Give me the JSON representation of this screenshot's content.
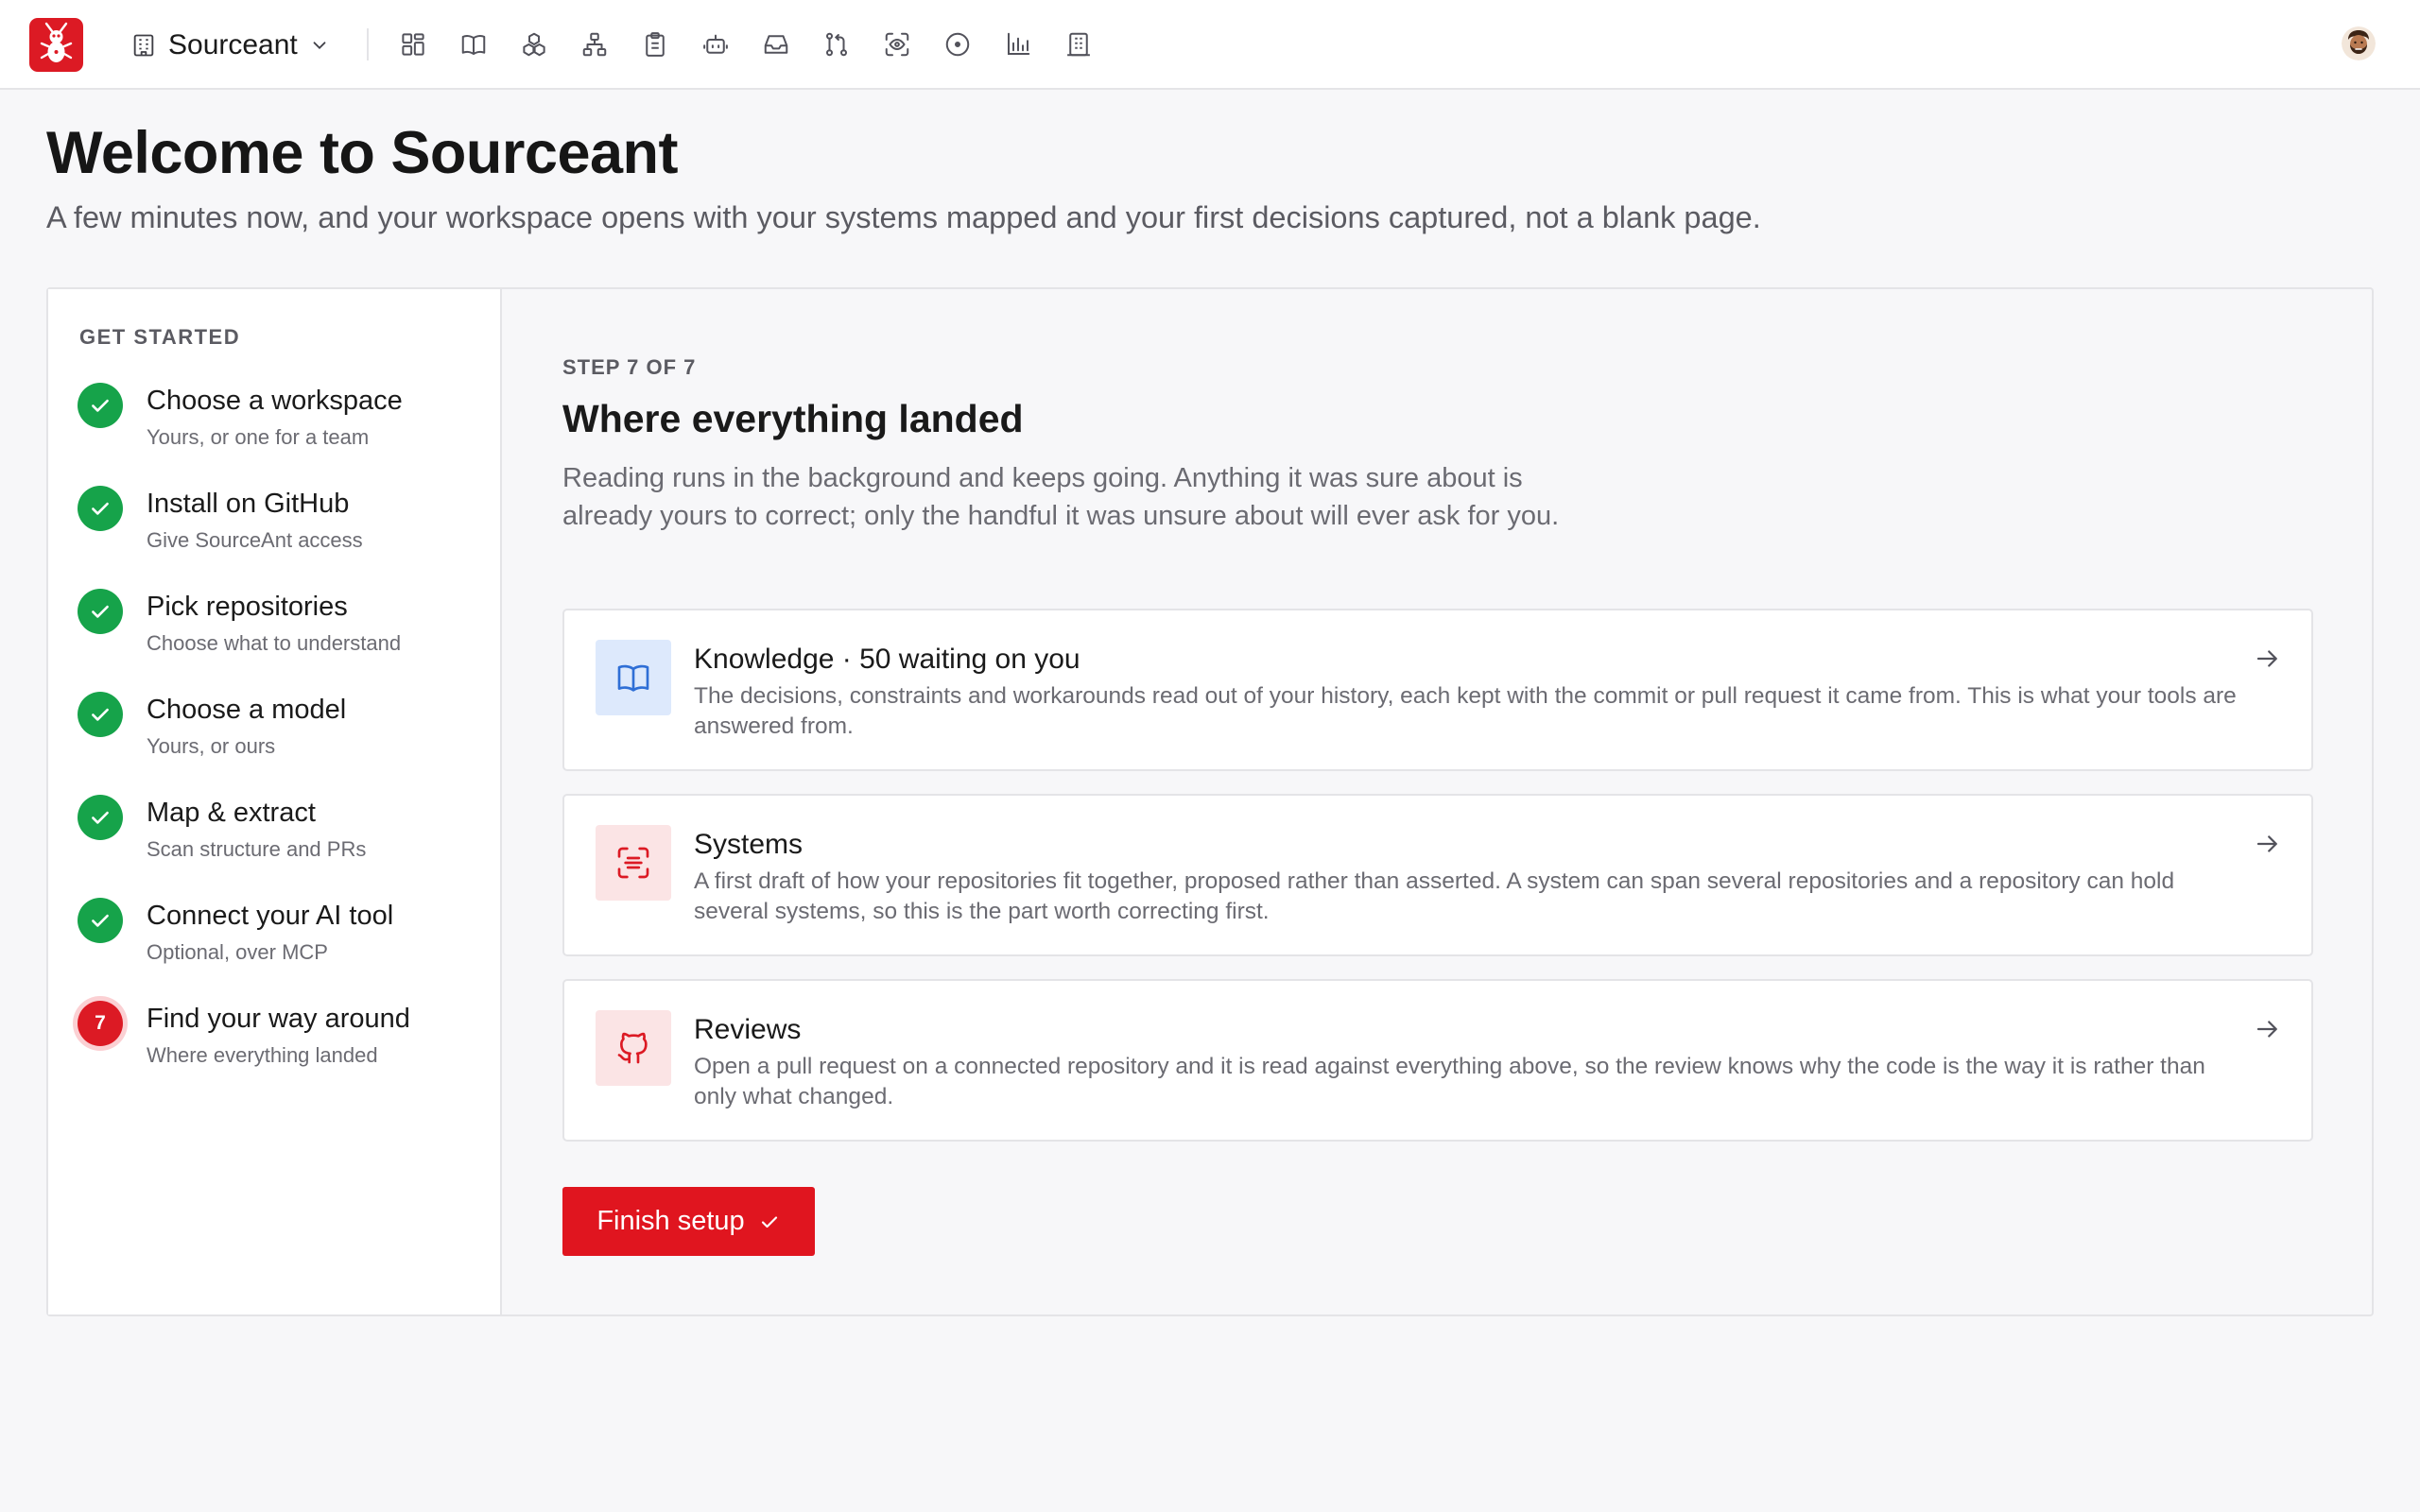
{
  "app": {
    "workspace_name": "Sourceant",
    "brand_color": "#dc1a24"
  },
  "nav": {
    "icons": [
      "dashboard-icon",
      "book-icon",
      "boxes-icon",
      "hierarchy-icon",
      "clipboard-icon",
      "bot-icon",
      "inbox-icon",
      "git-pull-request-icon",
      "scan-icon",
      "circle-dot-icon",
      "bar-chart-icon",
      "building-icon"
    ]
  },
  "page": {
    "title": "Welcome to Sourceant",
    "subtitle": "A few minutes now, and your workspace opens with your systems mapped and your first decisions captured, not a blank page."
  },
  "sidebar": {
    "heading": "GET STARTED",
    "steps": [
      {
        "title": "Choose a workspace",
        "subtitle": "Yours, or one for a team",
        "status": "done"
      },
      {
        "title": "Install on GitHub",
        "subtitle": "Give SourceAnt access",
        "status": "done"
      },
      {
        "title": "Pick repositories",
        "subtitle": "Choose what to understand",
        "status": "done"
      },
      {
        "title": "Choose a model",
        "subtitle": "Yours, or ours",
        "status": "done"
      },
      {
        "title": "Map & extract",
        "subtitle": "Scan structure and PRs",
        "status": "done"
      },
      {
        "title": "Connect your AI tool",
        "subtitle": "Optional, over MCP",
        "status": "done"
      },
      {
        "title": "Find your way around",
        "subtitle": "Where everything landed",
        "status": "current",
        "number": "7"
      }
    ]
  },
  "main": {
    "step_counter": "STEP 7 OF 7",
    "title": "Where everything landed",
    "description": "Reading runs in the background and keeps going. Anything it was sure about is already yours to correct; only the handful it was unsure about will ever ask for you.",
    "cards": [
      {
        "title": "Knowledge · 50 waiting on you",
        "description": "The decisions, constraints and workarounds read out of your history, each kept with the commit or pull request it came from. This is what your tools are answered from.",
        "icon": "book-icon",
        "accent": "#2f6fd6"
      },
      {
        "title": "Systems",
        "description": "A first draft of how your repositories fit together, proposed rather than asserted. A system can span several repositories and a repository can hold several systems, so this is the part worth correcting first.",
        "icon": "scan-icon",
        "accent": "#dc1a24"
      },
      {
        "title": "Reviews",
        "description": "Open a pull request on a connected repository and it is read against everything above, so the review knows why the code is the way it is rather than only what changed.",
        "icon": "github-icon",
        "accent": "#dc1a24"
      }
    ],
    "finish_label": "Finish setup"
  }
}
